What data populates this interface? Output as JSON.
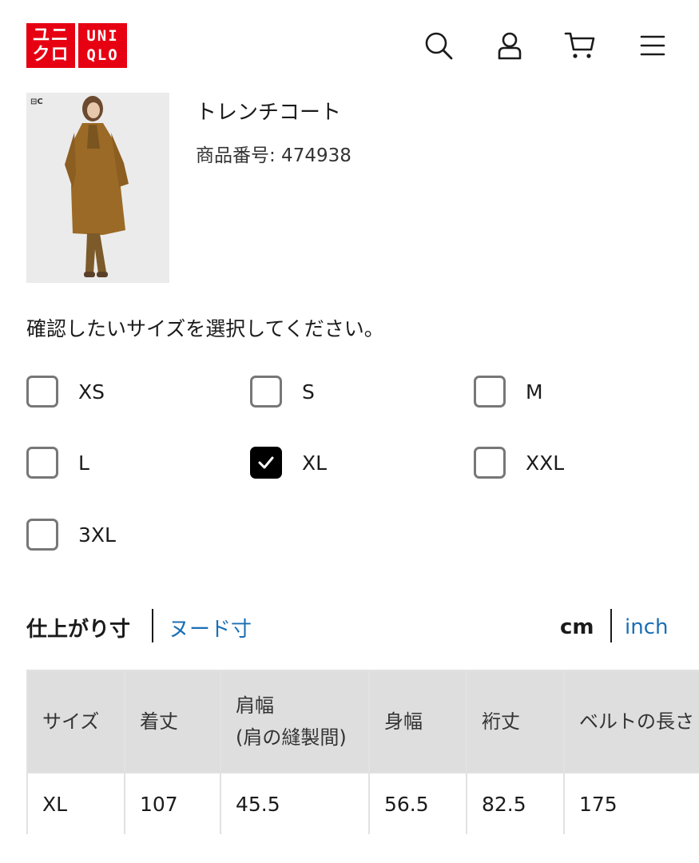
{
  "header": {
    "logo": {
      "line1": "ユニ",
      "line2": "クロ",
      "line3": "UNI",
      "line4": "QLO",
      "brand_color": "#e60012"
    },
    "icons": [
      "search-icon",
      "account-icon",
      "cart-icon",
      "menu-icon"
    ]
  },
  "product": {
    "badge": "⊟C",
    "name": "トレンチコート",
    "number": "商品番号: 474938"
  },
  "size_selector": {
    "instruction": "確認したいサイズを選択してください。",
    "sizes": [
      {
        "label": "XS",
        "checked": false
      },
      {
        "label": "S",
        "checked": false
      },
      {
        "label": "M",
        "checked": false
      },
      {
        "label": "L",
        "checked": false
      },
      {
        "label": "XL",
        "checked": true
      },
      {
        "label": "XXL",
        "checked": false
      },
      {
        "label": "3XL",
        "checked": false
      }
    ]
  },
  "measurement_tabs": {
    "finished": "仕上がり寸",
    "nude": "ヌード寸",
    "unit_cm": "cm",
    "unit_inch": "inch",
    "link_color": "#1a6fb5"
  },
  "size_table": {
    "headers": [
      "サイズ",
      "着丈",
      "肩幅",
      "(肩の縫製間)",
      "身幅",
      "裄丈",
      "ベルトの長さ"
    ],
    "rows": [
      [
        "XL",
        "107",
        "45.5",
        "56.5",
        "82.5",
        "175"
      ]
    ]
  }
}
